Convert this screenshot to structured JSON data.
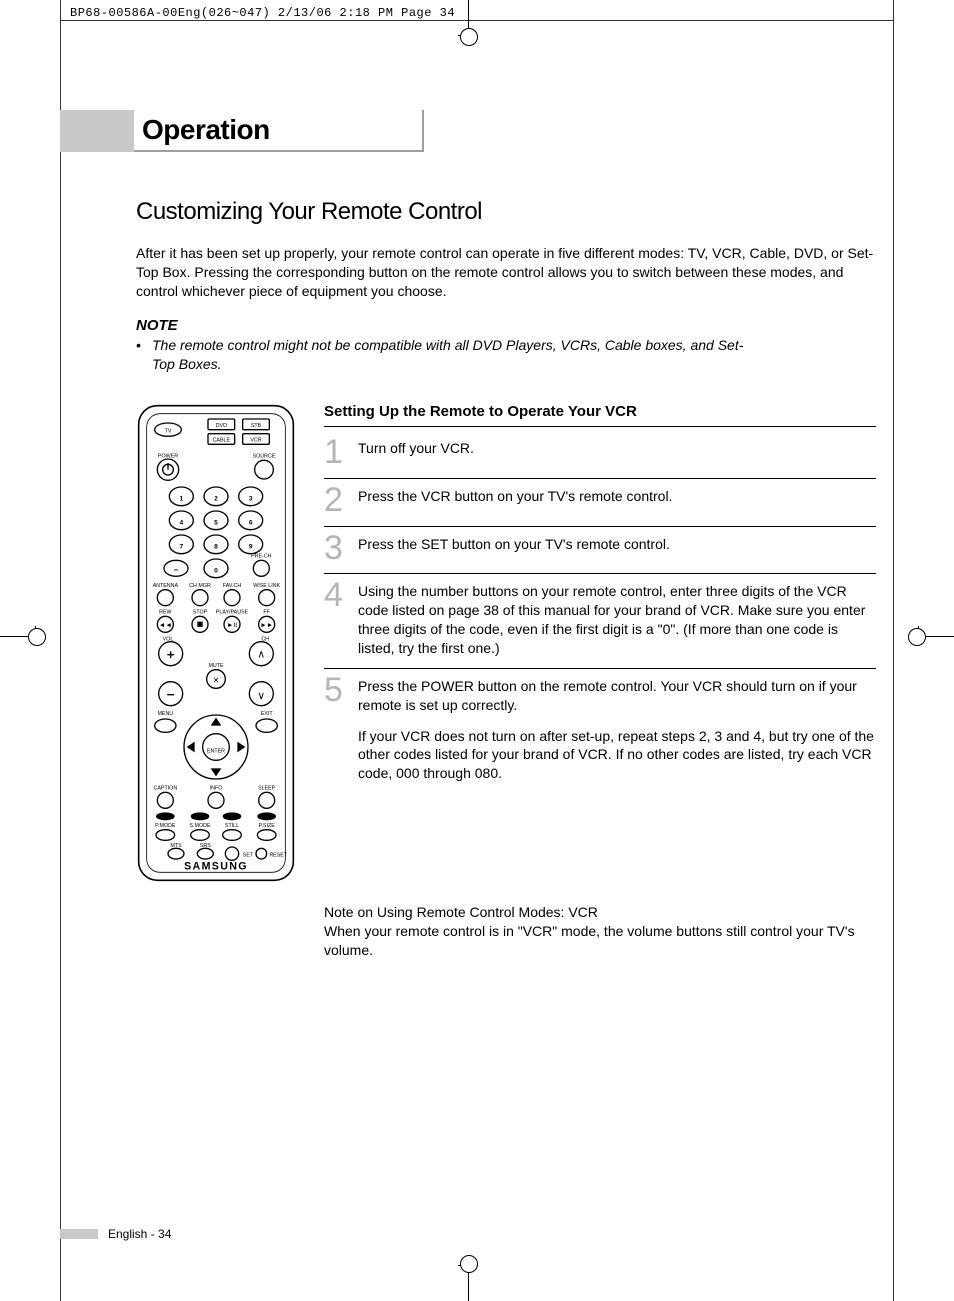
{
  "crop_header": "BP68-00586A-00Eng(026~047)  2/13/06  2:18 PM  Page 34",
  "section_title": "Operation",
  "subtitle": "Customizing Your Remote Control",
  "intro": "After it has been set up properly, your remote control can operate in five different modes: TV, VCR, Cable, DVD, or Set-Top Box. Pressing the corresponding button on the remote control allows you to switch between these modes, and control whichever piece of equipment you choose.",
  "note_label": "NOTE",
  "note_body": "The remote control might not be compatible with all DVD Players, VCRs, Cable boxes, and Set-Top Boxes.",
  "steps_title": "Setting Up the Remote to Operate Your VCR",
  "steps": [
    {
      "num": "1",
      "text": "Turn off your VCR."
    },
    {
      "num": "2",
      "text": "Press the VCR button on your TV's remote control."
    },
    {
      "num": "3",
      "text": "Press the SET button on your TV's remote control."
    },
    {
      "num": "4",
      "text": "Using the number buttons on your remote control, enter three digits of the VCR code listed on page 38 of this manual for your brand of VCR. Make sure you enter three digits of the code, even if the first digit is a \"0\". (If more than one code is listed, try the first one.)"
    },
    {
      "num": "5",
      "text": "Press the POWER button on the remote control. Your VCR should turn on if your remote is set up correctly.",
      "text2": "If your VCR does not turn on after set-up, repeat steps 2, 3 and 4, but try one of the other codes listed for your brand of VCR. If no other codes are listed, try each VCR code, 000 through 080."
    }
  ],
  "mode_note_title": "Note on Using Remote Control Modes: VCR",
  "mode_note_body": "When your remote control is in \"VCR\" mode, the volume buttons still control your TV's volume.",
  "footer": "English - 34",
  "remote": {
    "brand": "SAMSUNG",
    "mode_buttons": [
      "TV",
      "DVD",
      "STB",
      "CABLE",
      "VCR"
    ],
    "labels": {
      "power": "POWER",
      "source": "SOURCE",
      "prech": "PRE-CH",
      "antenna": "ANTENNA",
      "chmgr": "CH MGR",
      "favch": "FAV.CH",
      "wiselink": "WISE LINK",
      "rew": "REW",
      "stop": "STOP",
      "playpause": "PLAY/PAUSE",
      "ff": "FF",
      "vol": "VOL",
      "ch": "CH",
      "mute": "MUTE",
      "menu": "MENU",
      "exit": "EXIT",
      "enter": "ENTER",
      "caption": "CAPTION",
      "info": "INFO",
      "sleep": "SLEEP",
      "pmode": "P.MODE",
      "smode": "S.MODE",
      "still": "STILL",
      "psize": "P.SIZE",
      "mts": "MTS",
      "srs": "SRS",
      "set": "SET",
      "reset": "RESET"
    },
    "digits": [
      "1",
      "2",
      "3",
      "4",
      "5",
      "6",
      "7",
      "8",
      "9",
      "0"
    ]
  }
}
